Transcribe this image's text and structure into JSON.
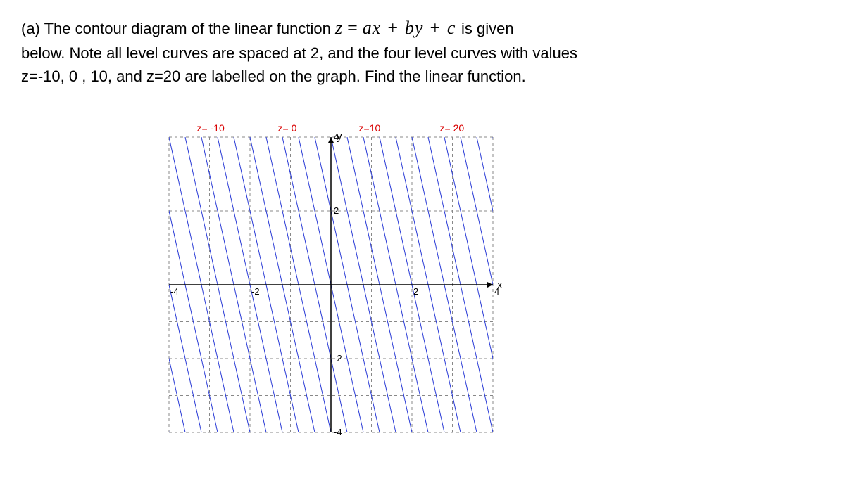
{
  "question": {
    "part": "(a)",
    "line1_a": "The contour diagram of the linear function ",
    "expr_lhs": "z",
    "expr_eq": "=",
    "expr_rhs": "ax + by + c",
    "line1_b": " is given",
    "line2": "below. Note all level curves are spaced at 2, and the four level curves with values",
    "line3": "z=-10, 0 , 10, and z=20 are labelled on the graph. Find the linear function."
  },
  "chart_data": {
    "type": "contour",
    "xlabel": "x",
    "ylabel": "y",
    "x_range": [
      -4,
      4
    ],
    "y_range": [
      -4,
      4
    ],
    "grid_spacing": 1,
    "ticks_x": {
      "-4": "-4",
      "-2": "-2",
      "2": "2",
      "4": "4"
    },
    "ticks_y": {
      "-4": "-4",
      "-2": "-2",
      "2": "2",
      "4": "4"
    },
    "contour_spacing_z": 2,
    "labelled_contours": [
      {
        "z": -10,
        "label": "z= -10",
        "x_at_y4": -3
      },
      {
        "z": 0,
        "label": "z= 0",
        "x_at_y4": -1
      },
      {
        "z": 10,
        "label": "z=10",
        "x_at_y4": 1
      },
      {
        "z": 20,
        "label": "z= 20",
        "x_at_y4": 3
      }
    ],
    "note": "Contours are straight lines with slope -5 in xy-plane; adjacent thin contours differ by z=2."
  }
}
